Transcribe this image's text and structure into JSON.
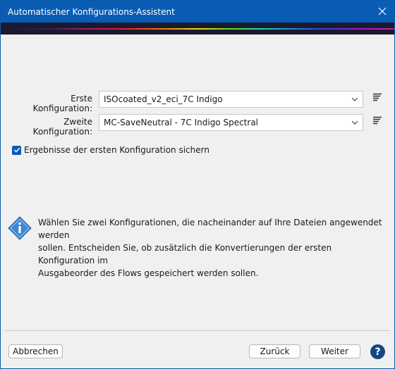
{
  "window": {
    "title": "Automatischer Konfigurations-Assistent"
  },
  "form": {
    "first_label": "Erste Konfiguration:",
    "first_value": "ISOcoated_v2_eci_7C Indigo",
    "second_label": "Zweite Konfiguration:",
    "second_value": "MC-SaveNeutral - 7C Indigo Spectral",
    "checkbox_label": "Ergebnisse der ersten Konfiguration sichern",
    "checkbox_checked": true
  },
  "info": {
    "line1": "Wählen Sie zwei Konfigurationen, die nacheinander auf Ihre Dateien angewendet werden",
    "line2": "sollen. Entscheiden Sie, ob zusätzlich die Konvertierungen der ersten Konfiguration im",
    "line3": "Ausgabeorder des Flows gespeichert werden sollen."
  },
  "buttons": {
    "cancel": "Abbrechen",
    "back": "Zurück",
    "next": "Weiter",
    "help": "?"
  },
  "colors": {
    "titlebar": "#0a5db5",
    "accent": "#0a5db5",
    "help_bg": "#16467f"
  }
}
